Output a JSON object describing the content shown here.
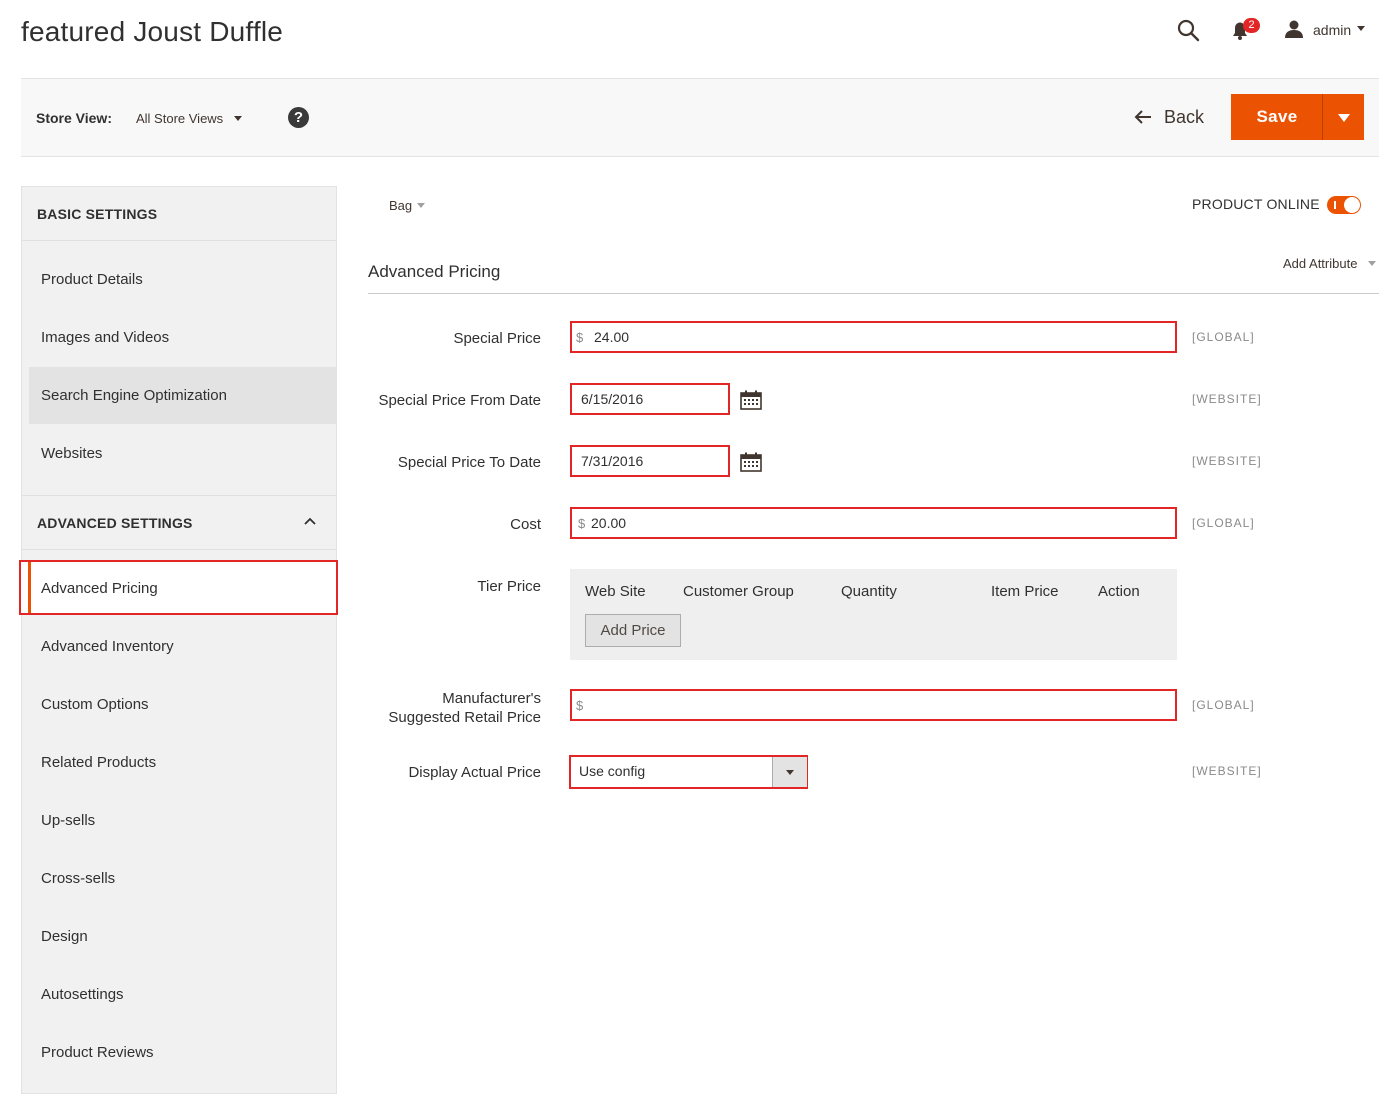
{
  "header": {
    "title": "featured Joust Duffle",
    "notifications_count": "2",
    "user": "admin"
  },
  "toolbar": {
    "store_view_label": "Store View:",
    "store_view_value": "All Store Views",
    "help": "?",
    "back_label": "Back",
    "save_label": "Save"
  },
  "sidebar": {
    "basic_heading": "BASIC SETTINGS",
    "basic_items": [
      "Product Details",
      "Images and Videos",
      "Search Engine Optimization",
      "Websites"
    ],
    "advanced_heading": "ADVANCED SETTINGS",
    "advanced_items": [
      "Advanced Pricing",
      "Advanced Inventory",
      "Custom Options",
      "Related Products",
      "Up-sells",
      "Cross-sells",
      "Design",
      "Autosettings",
      "Product Reviews"
    ]
  },
  "content": {
    "attribute_set": "Bag",
    "product_online_label": "PRODUCT ONLINE",
    "product_online": true,
    "section_title": "Advanced Pricing",
    "add_attribute": "Add Attribute"
  },
  "form": {
    "special_price": {
      "label": "Special Price",
      "prefix": "$",
      "value": "24.00",
      "scope": "[GLOBAL]"
    },
    "special_from": {
      "label": "Special Price From Date",
      "value": "6/15/2016",
      "scope": "[WEBSITE]"
    },
    "special_to": {
      "label": "Special Price To Date",
      "value": "7/31/2016",
      "scope": "[WEBSITE]"
    },
    "cost": {
      "label": "Cost",
      "prefix": "$",
      "value": "20.00",
      "scope": "[GLOBAL]"
    },
    "tier_price": {
      "label": "Tier Price",
      "columns": [
        "Web Site",
        "Customer Group",
        "Quantity",
        "Item Price",
        "Action"
      ],
      "add_button": "Add Price"
    },
    "msrp": {
      "label_line1": "Manufacturer's",
      "label_line2": "Suggested Retail Price",
      "prefix": "$",
      "value": "",
      "scope": "[GLOBAL]"
    },
    "display_actual_price": {
      "label": "Display Actual Price",
      "value": "Use config",
      "scope": "[WEBSITE]"
    }
  },
  "colors": {
    "accent": "#eb5202",
    "highlight_border": "#e22626",
    "sidebar_bg": "#f1f1f1"
  }
}
